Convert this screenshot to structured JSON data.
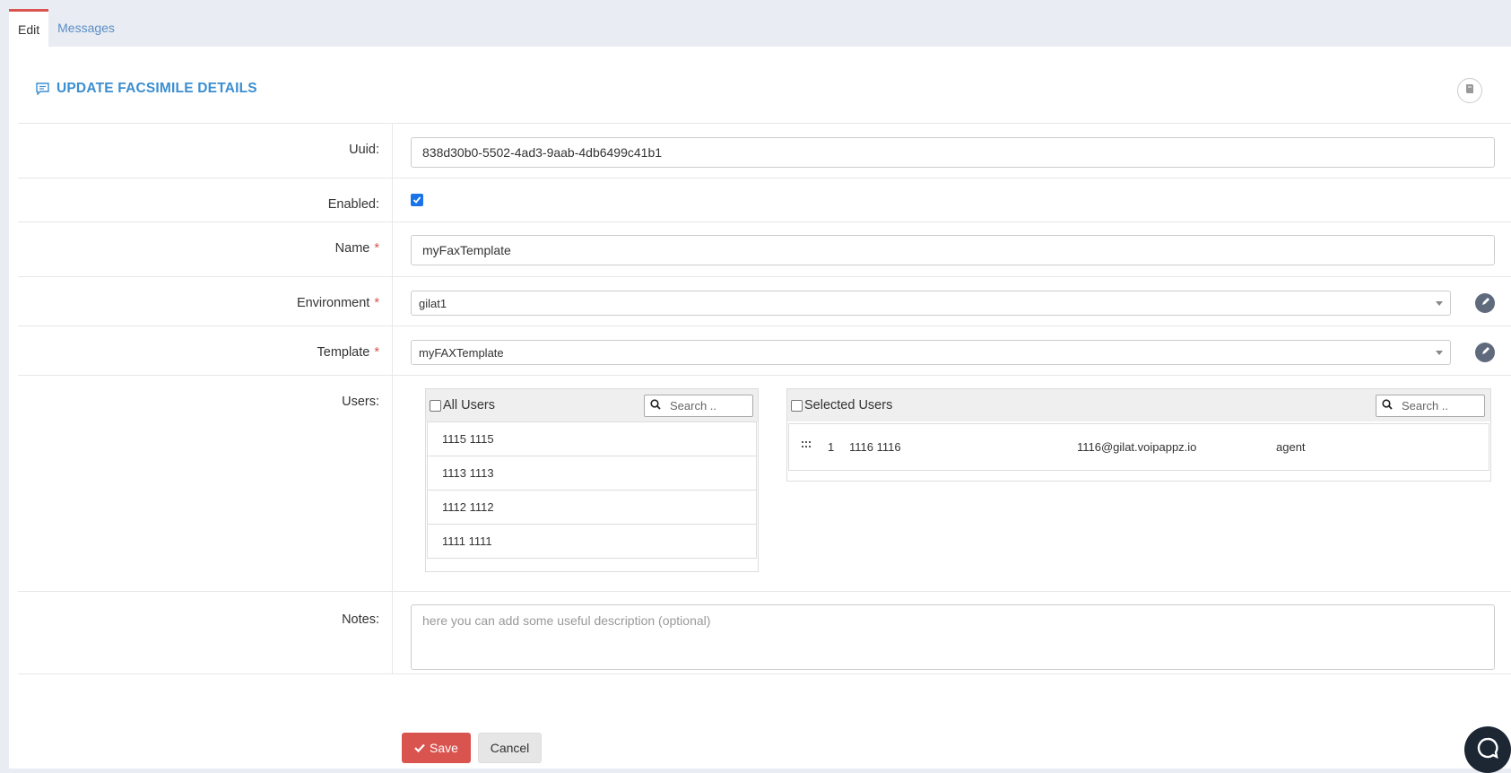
{
  "tabs": [
    {
      "label": "Edit",
      "active": true
    },
    {
      "label": "Messages",
      "active": false
    }
  ],
  "header": {
    "title": "UPDATE FACSIMILE DETAILS",
    "icon": "comment-icon",
    "help_icon": "book-icon"
  },
  "form": {
    "uuid": {
      "label": "Uuid:",
      "value": "838d30b0-5502-4ad3-9aab-4db6499c41b1"
    },
    "enabled": {
      "label": "Enabled:",
      "checked": true
    },
    "name": {
      "label": "Name",
      "required_mark": "*",
      "value": "myFaxTemplate"
    },
    "environment": {
      "label": "Environment",
      "required_mark": "*",
      "value": "gilat1"
    },
    "template": {
      "label": "Template",
      "required_mark": "*",
      "value": "myFAXTemplate"
    },
    "users": {
      "label": "Users:",
      "all_users": {
        "title": "All Users",
        "search_placeholder": "Search ..",
        "items": [
          "1115 1115",
          "1113 1113",
          "1112 1112",
          "1111 1111"
        ]
      },
      "selected_users": {
        "title": "Selected Users",
        "search_placeholder": "Search ..",
        "items": [
          {
            "index": "1",
            "name": "1116 1116",
            "email": "1116@gilat.voipappz.io",
            "role": "agent"
          }
        ]
      }
    },
    "notes": {
      "label": "Notes:",
      "placeholder": "here you can add some useful description (optional)"
    }
  },
  "actions": {
    "save_label": "Save",
    "cancel_label": "Cancel"
  },
  "colors": {
    "accent": "#3b8ed0",
    "danger": "#d9534f",
    "checkbox": "#1a73e8"
  }
}
